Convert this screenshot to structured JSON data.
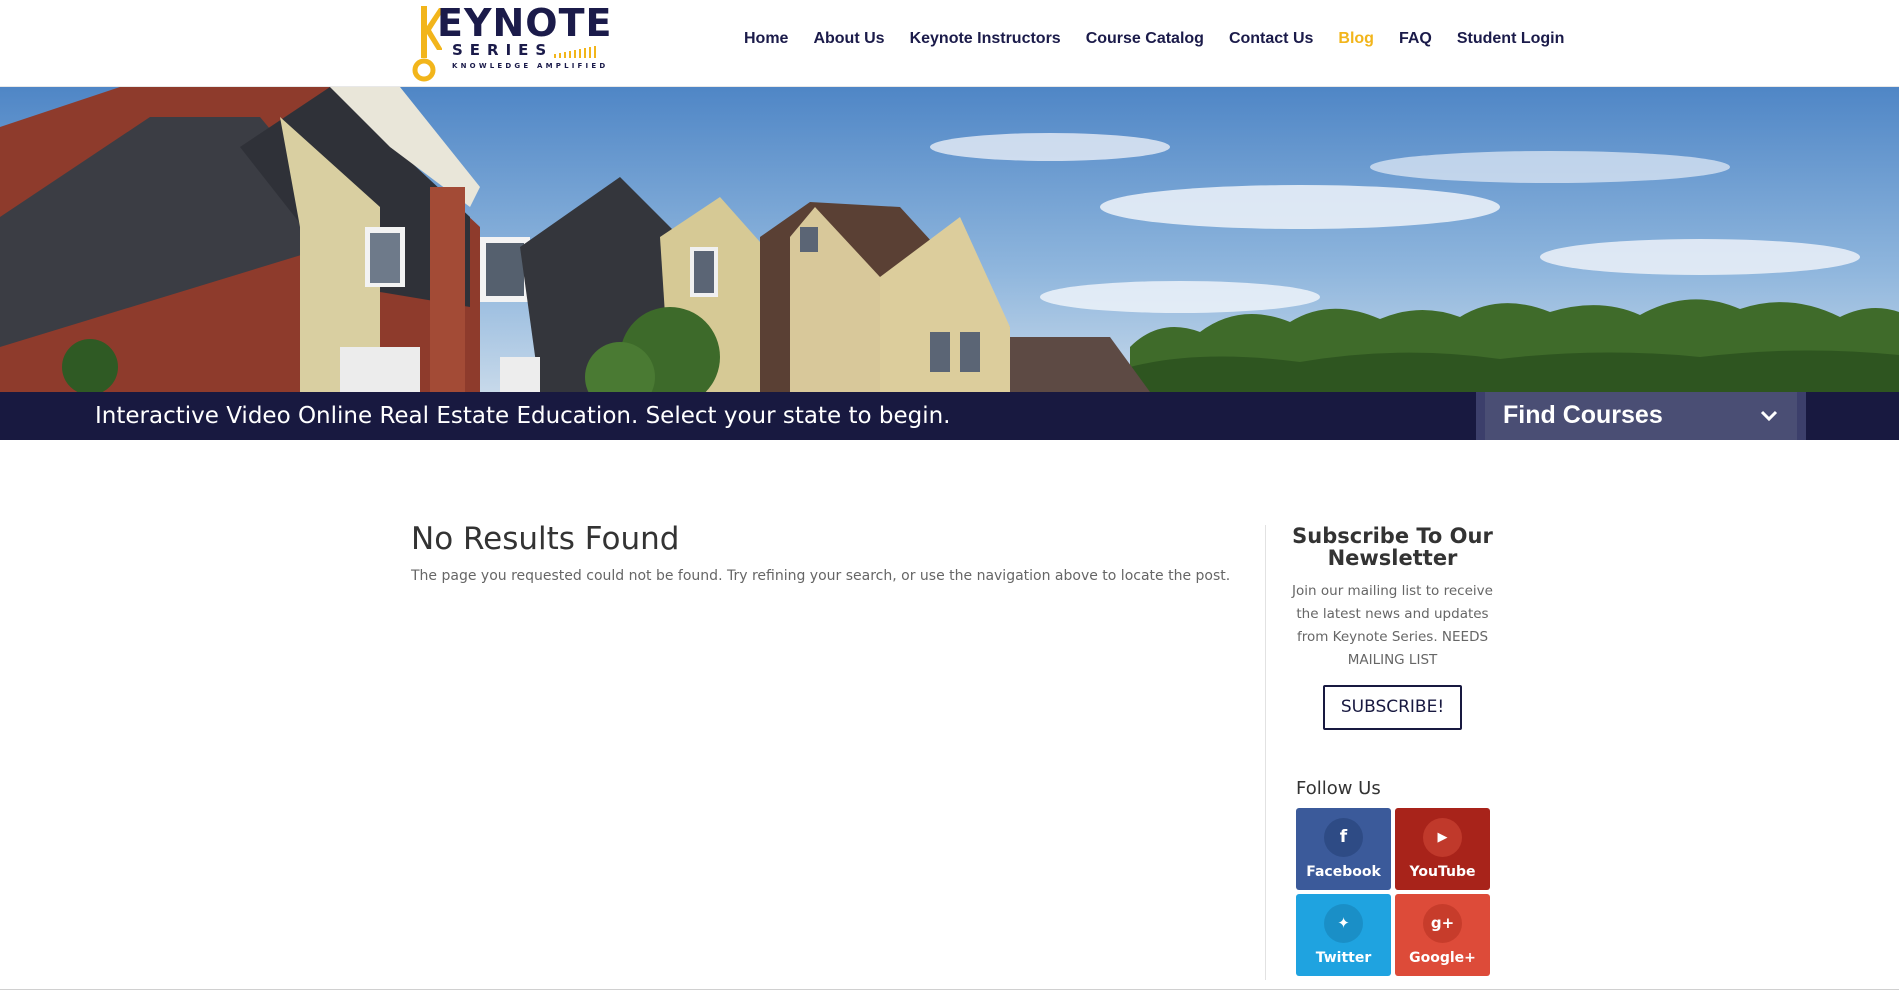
{
  "brand": {
    "logo_word": "EYNOTE",
    "logo_series": "SERIES",
    "logo_tagline": "KNOWLEDGE AMPLIFIED",
    "colors": {
      "navy": "#181940",
      "gold": "#f2b51b"
    }
  },
  "nav": {
    "items": [
      {
        "label": "Home"
      },
      {
        "label": "About Us"
      },
      {
        "label": "Keynote Instructors"
      },
      {
        "label": "Course Catalog"
      },
      {
        "label": "Contact Us"
      },
      {
        "label": "Blog",
        "active": true
      },
      {
        "label": "FAQ"
      },
      {
        "label": "Student Login"
      }
    ]
  },
  "hero": {
    "image": "house-neighborhood-photo"
  },
  "banner": {
    "text": "Interactive Video Online Real Estate Education. Select your state to begin.",
    "find_courses_label": "Find Courses",
    "find_courses_icon": "chevron-down-icon"
  },
  "main": {
    "title": "No Results Found",
    "text": "The page you requested could not be found. Try refining your search, or use the navigation above to locate the post."
  },
  "sidebar": {
    "newsletter_title": "Subscribe To Our Newsletter",
    "newsletter_text": "Join our mailing list to receive the latest news and updates from Keynote Series. NEEDS MAILING LIST",
    "subscribe_label": "SUBSCRIBE!",
    "follow_label": "Follow Us",
    "social": [
      {
        "label": "Facebook",
        "icon": "facebook-icon",
        "glyph": "f",
        "color": "#3b5a9a"
      },
      {
        "label": "YouTube",
        "icon": "youtube-icon",
        "glyph": "▶",
        "color": "#a8231a"
      },
      {
        "label": "Twitter",
        "icon": "twitter-icon",
        "glyph": "✦",
        "color": "#1fa3e0"
      },
      {
        "label": "Google+",
        "icon": "google-plus-icon",
        "glyph": "g+",
        "color": "#dd4b39"
      }
    ]
  }
}
